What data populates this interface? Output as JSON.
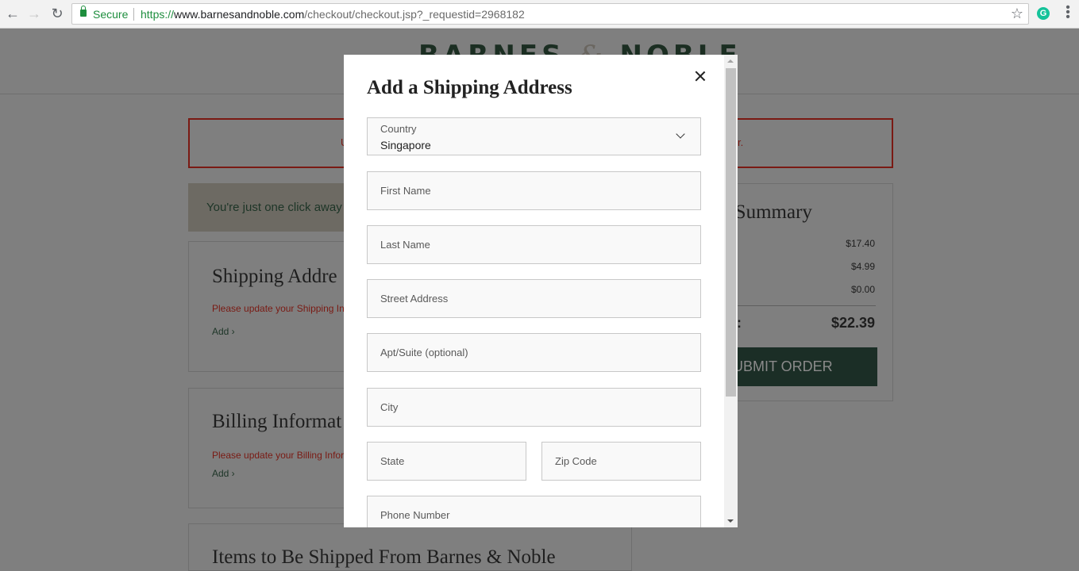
{
  "browser": {
    "back_icon": "arrow-left-icon",
    "forward_icon": "arrow-right-icon",
    "reload_icon": "reload-icon",
    "security_label": "Secure",
    "url_scheme": "https://",
    "url_host": "www.barnesandnoble.com",
    "url_path": "/checkout/checkout.jsp?_requestid=2968182",
    "bookmark_icon": "star-icon",
    "extension_letter": "G",
    "menu_icon": "more-vert-icon"
  },
  "page": {
    "logo_left": "BARNES",
    "logo_amp": "&",
    "logo_right": "NOBLE",
    "error_text_start": "U",
    "error_text_end": "r.",
    "promo_text": "You're just one click away f",
    "shipping": {
      "title": "Shipping Addre",
      "warning": "Please update your Shipping Inf",
      "add_link": "Add ›"
    },
    "billing": {
      "title": "Billing Informat",
      "warning": "Please update your Billing Infor",
      "add_link": "Add ›"
    },
    "next_section_title": "Items to Be Shipped From Barnes & Noble"
  },
  "order_summary": {
    "title": "er Summary",
    "rows": [
      {
        "label": ")",
        "value": "$17.40"
      },
      {
        "label": "",
        "value": "$4.99"
      },
      {
        "label": "",
        "value": "$0.00"
      }
    ],
    "total_label": "l:",
    "total_value": "$22.39",
    "submit_label": "UBMIT ORDER"
  },
  "modal": {
    "title": "Add a Shipping Address",
    "close_icon": "close-icon",
    "country": {
      "label": "Country",
      "value": "Singapore"
    },
    "fields": {
      "first_name": "First Name",
      "last_name": "Last Name",
      "street": "Street Address",
      "apt": "Apt/Suite (optional)",
      "city": "City",
      "state": "State",
      "zip": "Zip Code",
      "phone": "Phone Number"
    }
  },
  "colors": {
    "overlay": "#7f7f7f",
    "brand_green": "#1b2e26",
    "error_red": "#7a1a13",
    "secure_green": "#1e8e3e"
  }
}
